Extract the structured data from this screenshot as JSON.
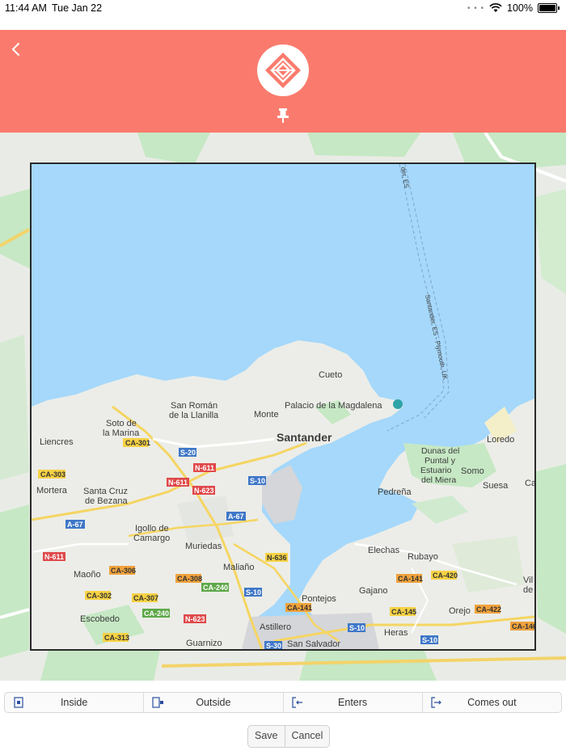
{
  "status_bar": {
    "time": "11:44 AM",
    "date": "Tue Jan 22",
    "battery": "100%"
  },
  "header": {
    "back_icon": "chevron-left-icon",
    "logo_icon": "diamond-logo-icon",
    "pin_icon": "pushpin-icon",
    "color": "#fa7b6d"
  },
  "map": {
    "labels": {
      "cueto": "Cueto",
      "palacio": "Palacio de la Magdalena",
      "san_roman_1": "San Román",
      "san_roman_2": "de la Llanilla",
      "monte": "Monte",
      "soto_1": "Soto de",
      "soto_2": "la Marina",
      "santander": "Santander",
      "liencres": "Liencres",
      "loredo": "Loredo",
      "dunas_1": "Dunas del",
      "dunas_2": "Puntal y",
      "dunas_3": "Estuario",
      "dunas_4": "del Miera",
      "somo": "Somo",
      "suesa": "Suesa",
      "ca_cut": "Ca",
      "mortera": "Mortera",
      "santa_cruz_1": "Santa Cruz",
      "santa_cruz_2": "de Bezana",
      "pedrena": "Pedreña",
      "igollo_1": "Igollo de",
      "igollo_2": "Camargo",
      "muriedas": "Muriedas",
      "elechas": "Elechas",
      "rubayo": "Rubayo",
      "maliano": "Maliaño",
      "maono": "Maoño",
      "vil_1": "Vil",
      "vil_2": "de",
      "pontejos": "Pontejos",
      "gajano": "Gajano",
      "escobedo": "Escobedo",
      "orejo": "Orejo",
      "astillero": "Astillero",
      "heras": "Heras",
      "guarnizo": "Guarnizo",
      "san_salvador": "San Salvador",
      "ferry_1": "Santander, ES - Plymouth, UK",
      "ferry_2": "der, ES"
    },
    "roads": {
      "ca301": "CA-301",
      "s20": "S-20",
      "ca303": "CA-303",
      "n611a": "N-611",
      "n611b": "N-611",
      "n623a": "N-623",
      "s10a": "S-10",
      "a67a": "A-67",
      "a67b": "A-67",
      "n611c": "N-611",
      "n636": "N-636",
      "ca306": "CA-306",
      "ca308": "CA-308",
      "ca240a": "CA-240",
      "ca141a": "CA-141",
      "ca420": "CA-420",
      "ca302": "CA-302",
      "ca307": "CA-307",
      "s10b": "S-10",
      "ca240b": "CA-240",
      "ca145": "CA-145",
      "ca422": "CA-422",
      "ca146": "CA-146",
      "n623b": "N-623",
      "ca141b": "CA-141",
      "s10c": "S-10",
      "ca313": "CA-313",
      "s30": "S-30",
      "s10d": "S-10"
    }
  },
  "toolbar": {
    "inside": "Inside",
    "outside": "Outside",
    "enters": "Enters",
    "comes_out": "Comes out"
  },
  "actions": {
    "save": "Save",
    "cancel": "Cancel"
  }
}
